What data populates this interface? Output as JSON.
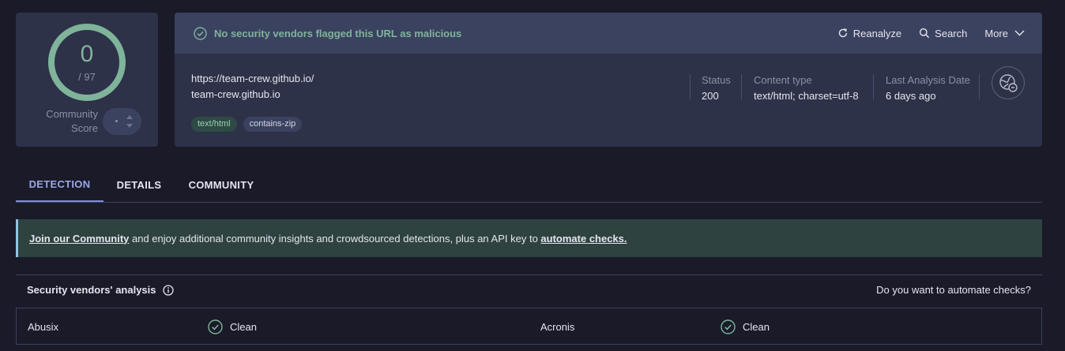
{
  "score": {
    "value": "0",
    "total": "/ 97",
    "community_label_line1": "Community",
    "community_label_line2": "Score",
    "ring_color": "#7fb49a"
  },
  "verdict": {
    "text": "No security vendors flagged this URL as malicious",
    "color": "#7fb49a"
  },
  "actions": {
    "reanalyze": "Reanalyze",
    "search": "Search",
    "more": "More"
  },
  "url": {
    "full": "https://team-crew.github.io/",
    "host": "team-crew.github.io"
  },
  "tags": [
    "text/html",
    "contains-zip"
  ],
  "meta": {
    "status_label": "Status",
    "status_value": "200",
    "content_label": "Content type",
    "content_value": "text/html; charset=utf-8",
    "date_label": "Last Analysis Date",
    "date_value": "6 days ago"
  },
  "tabs": [
    {
      "label": "DETECTION",
      "active": true
    },
    {
      "label": "DETAILS",
      "active": false
    },
    {
      "label": "COMMUNITY",
      "active": false
    }
  ],
  "banner": {
    "link1": "Join our Community",
    "middle": " and enjoy additional community insights and crowdsourced detections, plus an API key to ",
    "link2": "automate checks."
  },
  "vendors": {
    "title": "Security vendors' analysis",
    "cta": "Do you want to automate checks?",
    "rows": [
      [
        {
          "name": "Abusix",
          "result": "Clean"
        },
        {
          "name": "Acronis",
          "result": "Clean"
        }
      ]
    ]
  },
  "icons": {
    "verdict": "check-circle-icon",
    "reanalyze": "refresh-icon",
    "search": "search-icon",
    "more": "chevron-down-icon",
    "info": "info-icon",
    "globe": "globe-link-icon"
  }
}
